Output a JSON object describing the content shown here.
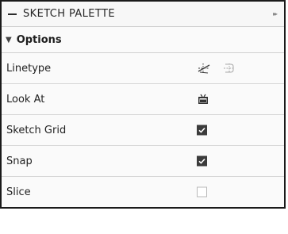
{
  "header": {
    "title": "SKETCH PALETTE"
  },
  "section": {
    "label": "Options"
  },
  "rows": [
    {
      "label": "Linetype",
      "controls": [
        "linetype-construction-icon",
        "linetype-centerline-icon"
      ]
    },
    {
      "label": "Look At",
      "controls": [
        "look-at-icon"
      ]
    },
    {
      "label": "Sketch Grid",
      "checked": true
    },
    {
      "label": "Snap",
      "checked": true
    },
    {
      "label": "Slice",
      "checked": false
    }
  ],
  "colors": {
    "checkbox_on": "#3b3b3b",
    "checkbox_off_border": "#b9b9b9",
    "divider": "#d7d7d7"
  }
}
